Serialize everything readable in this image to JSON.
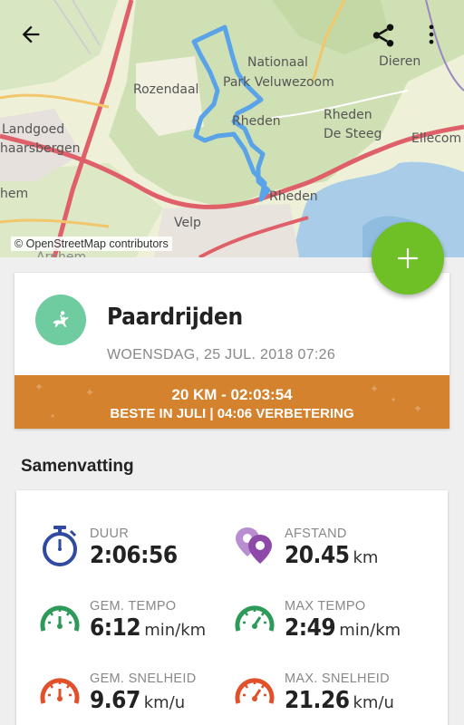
{
  "map": {
    "attribution": "© OpenStreetMap contributors",
    "labels": {
      "nationaal": "Nationaal",
      "park": "Park Veluwezoom",
      "dieren": "Dieren",
      "rozendaal": "Rozendaal",
      "rheden_center": "Rheden",
      "rheden_right": "Rheden",
      "desteeg": "De Steeg",
      "ellecom": "Ellecom",
      "landgoed": "Landgoed",
      "haarsbergen": "haarsbergen",
      "hem": "hem",
      "rheden_bottom": "Rheden",
      "velp": "Velp",
      "arnhem": "Arnhem"
    },
    "route_color": "#5aa3e8"
  },
  "activity": {
    "title": "Paardrijden",
    "date": "WOENSDAG, 25 JUL. 2018 07:26",
    "icon": "horse-riding-icon",
    "icon_color": "#6ecca0",
    "banner_line1": "20 KM  -  02:03:54",
    "banner_line2": "BESTE IN JULI  |  04:06 VERBETERING",
    "banner_color": "#d5822e"
  },
  "summary": {
    "title": "Samenvatting",
    "stats": [
      {
        "label": "DUUR",
        "value": "2:06:56",
        "unit": "",
        "icon": "stopwatch-icon"
      },
      {
        "label": "AFSTAND",
        "value": "20.45",
        "unit": "km",
        "icon": "map-pin-icon"
      },
      {
        "label": "GEM. TEMPO",
        "value": "6:12",
        "unit": "min/km",
        "icon": "gauge-icon"
      },
      {
        "label": "MAX TEMPO",
        "value": "2:49",
        "unit": "min/km",
        "icon": "gauge-icon"
      },
      {
        "label": "GEM. SNELHEID",
        "value": "9.67",
        "unit": "km/u",
        "icon": "speedometer-icon"
      },
      {
        "label": "MAX. SNELHEID",
        "value": "21.26",
        "unit": "km/u",
        "icon": "speedometer-icon"
      }
    ]
  },
  "colors": {
    "fab": "#6fbf26",
    "stopwatch": "#2f4aa0",
    "pin": "#8e4aa8",
    "tempo": "#2e9a5a",
    "speed": "#e0502a"
  }
}
